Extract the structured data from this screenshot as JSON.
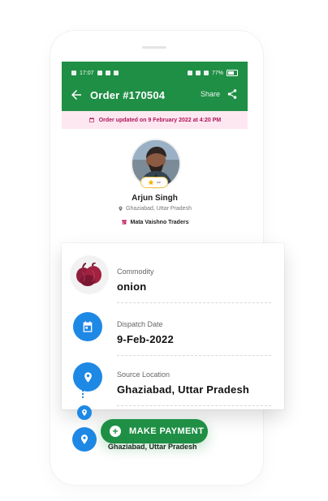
{
  "status_bar": {
    "time": "17:07",
    "battery": "77%"
  },
  "header": {
    "title": "Order #170504",
    "share_label": "Share"
  },
  "banner": {
    "text": "Order updated on 9 February 2022 at 4:20 PM"
  },
  "seller": {
    "rating": "--",
    "name": "Arjun Singh",
    "location": "Ghaziabad, Uttar Pradesh",
    "shop": "Mata Vaishno Traders"
  },
  "details": {
    "commodity_label": "Commodity",
    "commodity_value": "onion",
    "dispatch_label": "Dispatch Date",
    "dispatch_value": "9-Feb-2022",
    "source_label": "Source Location",
    "source_value": "Ghaziabad, Uttar Pradesh"
  },
  "lower": {
    "location_value": "Ghaziabad, Uttar Pradesh"
  },
  "cta": {
    "label": "MAKE PAYMENT"
  },
  "colors": {
    "brand_green": "#1f8f45",
    "banner_bg": "#fde8f1",
    "banner_text": "#b1145b",
    "blue_icon": "#1e88e5"
  },
  "icons": {
    "back": "arrow-left-icon",
    "share": "share-icon",
    "calendar": "calendar-icon",
    "location": "location-pin-icon",
    "shop": "store-icon",
    "star": "star-icon",
    "plus": "plus-icon",
    "onion": "onion-image"
  }
}
